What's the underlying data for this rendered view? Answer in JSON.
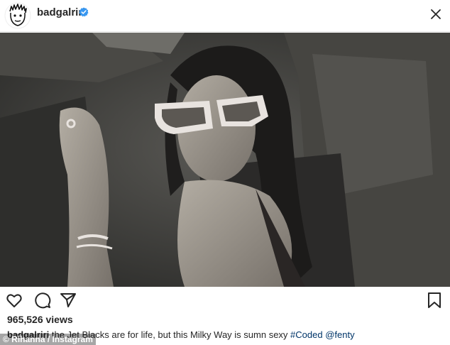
{
  "header": {
    "username": "badgalriri",
    "verified_icon": "verified-badge-icon",
    "close_icon": "close-icon",
    "accent_color": "#3897f0"
  },
  "media": {
    "type": "video-frame"
  },
  "actions": {
    "like_icon": "heart-icon",
    "comment_icon": "comment-icon",
    "share_icon": "paper-plane-icon",
    "save_icon": "bookmark-icon"
  },
  "post": {
    "views": "965,526 views",
    "caption_user": "badgalriri",
    "caption_text": " the Jet Blacks are for life, but this Milky Way is sumn sexy ",
    "hashtag": "#Coded",
    "mention": "@fenty"
  },
  "credit": "© Rihanna / Instagram"
}
